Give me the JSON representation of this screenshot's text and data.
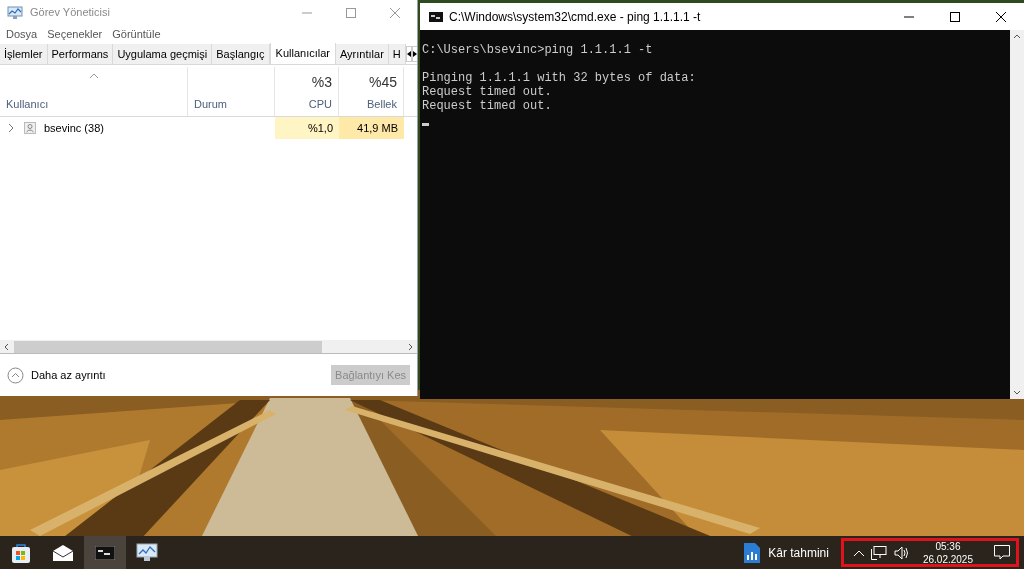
{
  "task_manager": {
    "title": "Görev Yöneticisi",
    "menu": [
      "Dosya",
      "Seçenekler",
      "Görüntüle"
    ],
    "tabs": [
      {
        "label": "İşlemler",
        "selected": false
      },
      {
        "label": "Performans",
        "selected": false
      },
      {
        "label": "Uygulama geçmişi",
        "selected": false
      },
      {
        "label": "Başlangıç",
        "selected": false
      },
      {
        "label": "Kullanıcılar",
        "selected": true
      },
      {
        "label": "Ayrıntılar",
        "selected": false
      },
      {
        "label": "H",
        "selected": false
      }
    ],
    "columns": [
      {
        "kind": "name",
        "label": "Kullanıcı"
      },
      {
        "kind": "status",
        "label": "Durum"
      },
      {
        "kind": "metric",
        "summary": "%3",
        "label": "CPU"
      },
      {
        "kind": "metric",
        "summary": "%45",
        "label": "Bellek"
      }
    ],
    "rows": [
      {
        "name": "bsevinc (38)",
        "expanded": false,
        "cpu": "%1,0",
        "memory": "41,9 MB"
      }
    ],
    "footer": {
      "toggle": "Daha az ayrıntı",
      "button": {
        "label": "Bağlantıyı Kes",
        "disabled": true
      }
    }
  },
  "console": {
    "title": "C:\\Windows\\system32\\cmd.exe - ping  1.1.1.1 -t",
    "lines": [
      {
        "kind": "prompt",
        "text": "C:\\Users\\bsevinc>ping 1.1.1.1 -t"
      },
      {
        "kind": "output",
        "text": "Pinging 1.1.1.1 with 32 bytes of data:"
      },
      {
        "kind": "output",
        "text": "Request timed out."
      },
      {
        "kind": "output",
        "text": "Request timed out."
      }
    ]
  },
  "taskbar": {
    "apps": [
      {
        "kind": "store",
        "selected": false
      },
      {
        "kind": "mail",
        "selected": false
      },
      {
        "kind": "terminal",
        "selected": true
      },
      {
        "kind": "monitor",
        "selected": false
      }
    ],
    "pinned_file": {
      "label": "Kâr tahmini"
    },
    "clock": {
      "time": "05:36",
      "date": "26.02.2025"
    },
    "tray_highlighted": true
  }
}
